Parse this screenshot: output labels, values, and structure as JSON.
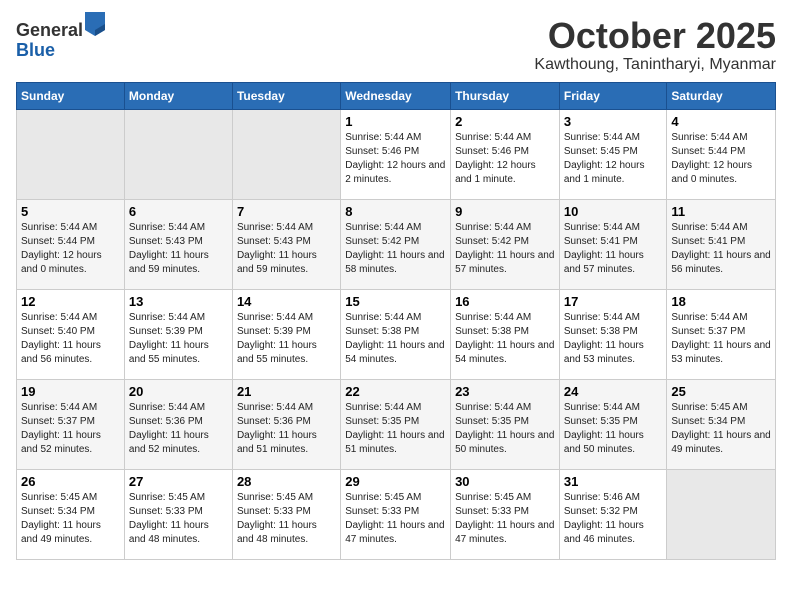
{
  "logo": {
    "general": "General",
    "blue": "Blue"
  },
  "title": "October 2025",
  "location": "Kawthoung, Tanintharyi, Myanmar",
  "weekdays": [
    "Sunday",
    "Monday",
    "Tuesday",
    "Wednesday",
    "Thursday",
    "Friday",
    "Saturday"
  ],
  "weeks": [
    [
      {
        "day": "",
        "sunrise": "",
        "sunset": "",
        "daylight": ""
      },
      {
        "day": "",
        "sunrise": "",
        "sunset": "",
        "daylight": ""
      },
      {
        "day": "",
        "sunrise": "",
        "sunset": "",
        "daylight": ""
      },
      {
        "day": "1",
        "sunrise": "Sunrise: 5:44 AM",
        "sunset": "Sunset: 5:46 PM",
        "daylight": "Daylight: 12 hours and 2 minutes."
      },
      {
        "day": "2",
        "sunrise": "Sunrise: 5:44 AM",
        "sunset": "Sunset: 5:46 PM",
        "daylight": "Daylight: 12 hours and 1 minute."
      },
      {
        "day": "3",
        "sunrise": "Sunrise: 5:44 AM",
        "sunset": "Sunset: 5:45 PM",
        "daylight": "Daylight: 12 hours and 1 minute."
      },
      {
        "day": "4",
        "sunrise": "Sunrise: 5:44 AM",
        "sunset": "Sunset: 5:44 PM",
        "daylight": "Daylight: 12 hours and 0 minutes."
      }
    ],
    [
      {
        "day": "5",
        "sunrise": "Sunrise: 5:44 AM",
        "sunset": "Sunset: 5:44 PM",
        "daylight": "Daylight: 12 hours and 0 minutes."
      },
      {
        "day": "6",
        "sunrise": "Sunrise: 5:44 AM",
        "sunset": "Sunset: 5:43 PM",
        "daylight": "Daylight: 11 hours and 59 minutes."
      },
      {
        "day": "7",
        "sunrise": "Sunrise: 5:44 AM",
        "sunset": "Sunset: 5:43 PM",
        "daylight": "Daylight: 11 hours and 59 minutes."
      },
      {
        "day": "8",
        "sunrise": "Sunrise: 5:44 AM",
        "sunset": "Sunset: 5:42 PM",
        "daylight": "Daylight: 11 hours and 58 minutes."
      },
      {
        "day": "9",
        "sunrise": "Sunrise: 5:44 AM",
        "sunset": "Sunset: 5:42 PM",
        "daylight": "Daylight: 11 hours and 57 minutes."
      },
      {
        "day": "10",
        "sunrise": "Sunrise: 5:44 AM",
        "sunset": "Sunset: 5:41 PM",
        "daylight": "Daylight: 11 hours and 57 minutes."
      },
      {
        "day": "11",
        "sunrise": "Sunrise: 5:44 AM",
        "sunset": "Sunset: 5:41 PM",
        "daylight": "Daylight: 11 hours and 56 minutes."
      }
    ],
    [
      {
        "day": "12",
        "sunrise": "Sunrise: 5:44 AM",
        "sunset": "Sunset: 5:40 PM",
        "daylight": "Daylight: 11 hours and 56 minutes."
      },
      {
        "day": "13",
        "sunrise": "Sunrise: 5:44 AM",
        "sunset": "Sunset: 5:39 PM",
        "daylight": "Daylight: 11 hours and 55 minutes."
      },
      {
        "day": "14",
        "sunrise": "Sunrise: 5:44 AM",
        "sunset": "Sunset: 5:39 PM",
        "daylight": "Daylight: 11 hours and 55 minutes."
      },
      {
        "day": "15",
        "sunrise": "Sunrise: 5:44 AM",
        "sunset": "Sunset: 5:38 PM",
        "daylight": "Daylight: 11 hours and 54 minutes."
      },
      {
        "day": "16",
        "sunrise": "Sunrise: 5:44 AM",
        "sunset": "Sunset: 5:38 PM",
        "daylight": "Daylight: 11 hours and 54 minutes."
      },
      {
        "day": "17",
        "sunrise": "Sunrise: 5:44 AM",
        "sunset": "Sunset: 5:38 PM",
        "daylight": "Daylight: 11 hours and 53 minutes."
      },
      {
        "day": "18",
        "sunrise": "Sunrise: 5:44 AM",
        "sunset": "Sunset: 5:37 PM",
        "daylight": "Daylight: 11 hours and 53 minutes."
      }
    ],
    [
      {
        "day": "19",
        "sunrise": "Sunrise: 5:44 AM",
        "sunset": "Sunset: 5:37 PM",
        "daylight": "Daylight: 11 hours and 52 minutes."
      },
      {
        "day": "20",
        "sunrise": "Sunrise: 5:44 AM",
        "sunset": "Sunset: 5:36 PM",
        "daylight": "Daylight: 11 hours and 52 minutes."
      },
      {
        "day": "21",
        "sunrise": "Sunrise: 5:44 AM",
        "sunset": "Sunset: 5:36 PM",
        "daylight": "Daylight: 11 hours and 51 minutes."
      },
      {
        "day": "22",
        "sunrise": "Sunrise: 5:44 AM",
        "sunset": "Sunset: 5:35 PM",
        "daylight": "Daylight: 11 hours and 51 minutes."
      },
      {
        "day": "23",
        "sunrise": "Sunrise: 5:44 AM",
        "sunset": "Sunset: 5:35 PM",
        "daylight": "Daylight: 11 hours and 50 minutes."
      },
      {
        "day": "24",
        "sunrise": "Sunrise: 5:44 AM",
        "sunset": "Sunset: 5:35 PM",
        "daylight": "Daylight: 11 hours and 50 minutes."
      },
      {
        "day": "25",
        "sunrise": "Sunrise: 5:45 AM",
        "sunset": "Sunset: 5:34 PM",
        "daylight": "Daylight: 11 hours and 49 minutes."
      }
    ],
    [
      {
        "day": "26",
        "sunrise": "Sunrise: 5:45 AM",
        "sunset": "Sunset: 5:34 PM",
        "daylight": "Daylight: 11 hours and 49 minutes."
      },
      {
        "day": "27",
        "sunrise": "Sunrise: 5:45 AM",
        "sunset": "Sunset: 5:33 PM",
        "daylight": "Daylight: 11 hours and 48 minutes."
      },
      {
        "day": "28",
        "sunrise": "Sunrise: 5:45 AM",
        "sunset": "Sunset: 5:33 PM",
        "daylight": "Daylight: 11 hours and 48 minutes."
      },
      {
        "day": "29",
        "sunrise": "Sunrise: 5:45 AM",
        "sunset": "Sunset: 5:33 PM",
        "daylight": "Daylight: 11 hours and 47 minutes."
      },
      {
        "day": "30",
        "sunrise": "Sunrise: 5:45 AM",
        "sunset": "Sunset: 5:33 PM",
        "daylight": "Daylight: 11 hours and 47 minutes."
      },
      {
        "day": "31",
        "sunrise": "Sunrise: 5:46 AM",
        "sunset": "Sunset: 5:32 PM",
        "daylight": "Daylight: 11 hours and 46 minutes."
      },
      {
        "day": "",
        "sunrise": "",
        "sunset": "",
        "daylight": ""
      }
    ]
  ]
}
